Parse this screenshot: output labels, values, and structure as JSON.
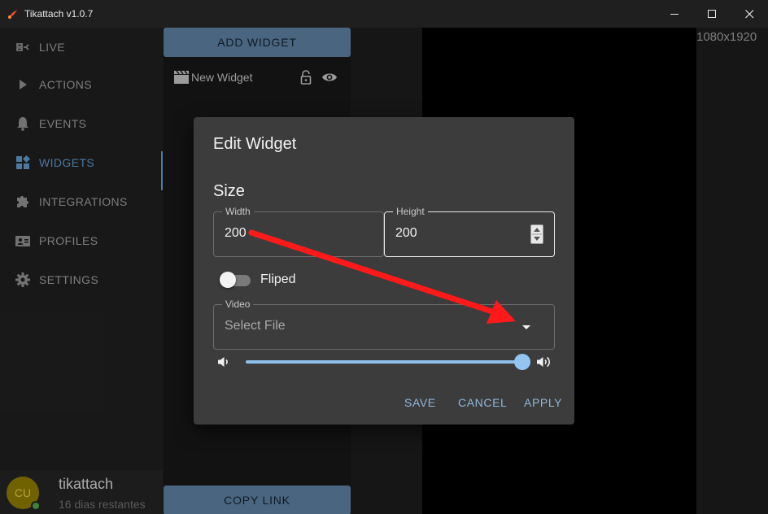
{
  "window": {
    "title": "Tikattach v1.0.7"
  },
  "sidebar": {
    "items": [
      {
        "label": "LIVE",
        "icon": "live-icon"
      },
      {
        "label": "ACTIONS",
        "icon": "play-icon"
      },
      {
        "label": "EVENTS",
        "icon": "bell-icon"
      },
      {
        "label": "WIDGETS",
        "icon": "widgets-icon",
        "active": true
      },
      {
        "label": "INTEGRATIONS",
        "icon": "puzzle-icon"
      },
      {
        "label": "PROFILES",
        "icon": "profile-card-icon"
      },
      {
        "label": "SETTINGS",
        "icon": "gear-icon"
      }
    ],
    "user": {
      "initials": "CU",
      "name": "tikattach",
      "subtitle": "16 dias restantes",
      "status": "online"
    }
  },
  "widgets_panel": {
    "add_label": "ADD WIDGET",
    "copy_label": "COPY LINK",
    "items": [
      {
        "name": "New Widget",
        "icon": "clapperboard-icon"
      }
    ]
  },
  "preview": {
    "resolution": "1080x1920"
  },
  "dialog": {
    "title": "Edit Widget",
    "size_section": "Size",
    "width": {
      "label": "Width",
      "value": "200"
    },
    "height": {
      "label": "Height",
      "value": "200"
    },
    "fliped": {
      "label": "Fliped",
      "on": false
    },
    "video": {
      "label": "Video",
      "placeholder": "Select File"
    },
    "volume": {
      "level": 1.0
    },
    "buttons": {
      "save": "SAVE",
      "cancel": "CANCEL",
      "apply": "APPLY"
    }
  },
  "colors": {
    "accent": "#5f93c4",
    "button_blue": "#5b7c9c",
    "slider": "#8fc0ec",
    "annotation_arrow": "#ff1a1a"
  }
}
